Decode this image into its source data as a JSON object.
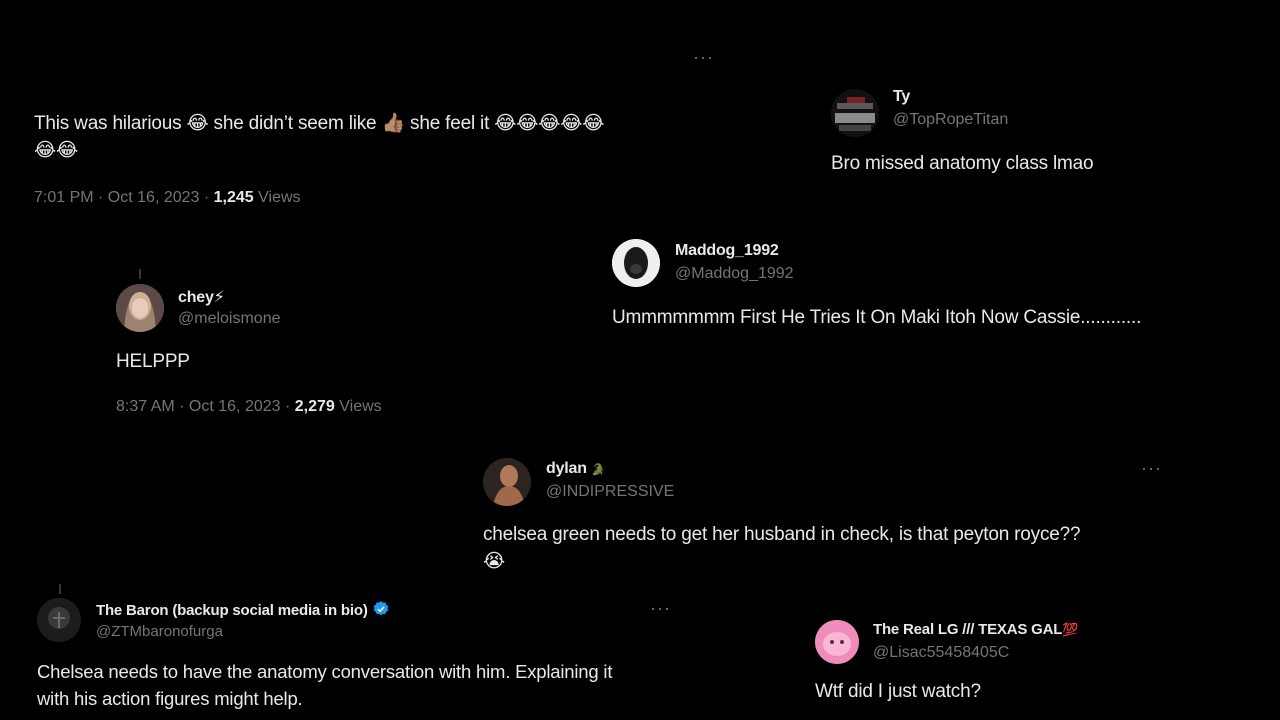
{
  "tweet_main": {
    "more_label": "···",
    "text": "This was hilarious 😂 she didn’t seem like 👍🏽 she feel it 😂😂😂😂😂",
    "text_line2": "😂😂",
    "time": "7:01 PM · Oct 16, 2023 · ",
    "views_count": "1,245",
    "views_label": " Views"
  },
  "tweet_ty": {
    "name": "Ty",
    "handle": "@TopRopeTitan",
    "text": "Bro missed anatomy class lmao"
  },
  "tweet_maddog": {
    "name": "Maddog_1992",
    "handle": "@Maddog_1992",
    "text": "Ummmmmmm First He Tries It On Maki Itoh Now Cassie............"
  },
  "tweet_chey": {
    "name": "chey⚡",
    "handle": "@meloismone",
    "text": "HELPPP",
    "time": "8:37 AM · Oct 16, 2023 · ",
    "views_count": "2,279",
    "views_label": " Views"
  },
  "tweet_dylan": {
    "name": "dylan",
    "name_suffix": "🐊",
    "handle": "@INDIPRESSIVE",
    "more_label": "···",
    "text": "chelsea green needs to get her husband in check, is that peyton royce??",
    "text_line2": "😭"
  },
  "tweet_baron": {
    "name": "The Baron (backup social media in bio)",
    "handle": "@ZTMbaronofurga",
    "more_label": "···",
    "text": "Chelsea needs to have the anatomy conversation with him. Explaining it",
    "text_line2": "with his action figures might help."
  },
  "tweet_lg": {
    "name": "The Real LG /// TEXAS GAL",
    "name_suffix": "💯",
    "handle": "@Lisac55458405C",
    "text": "Wtf did I just watch?"
  },
  "colors": {
    "background": "#000000",
    "text": "#e7e9ea",
    "secondary": "#71767b",
    "verified": "#1d9bf0"
  }
}
